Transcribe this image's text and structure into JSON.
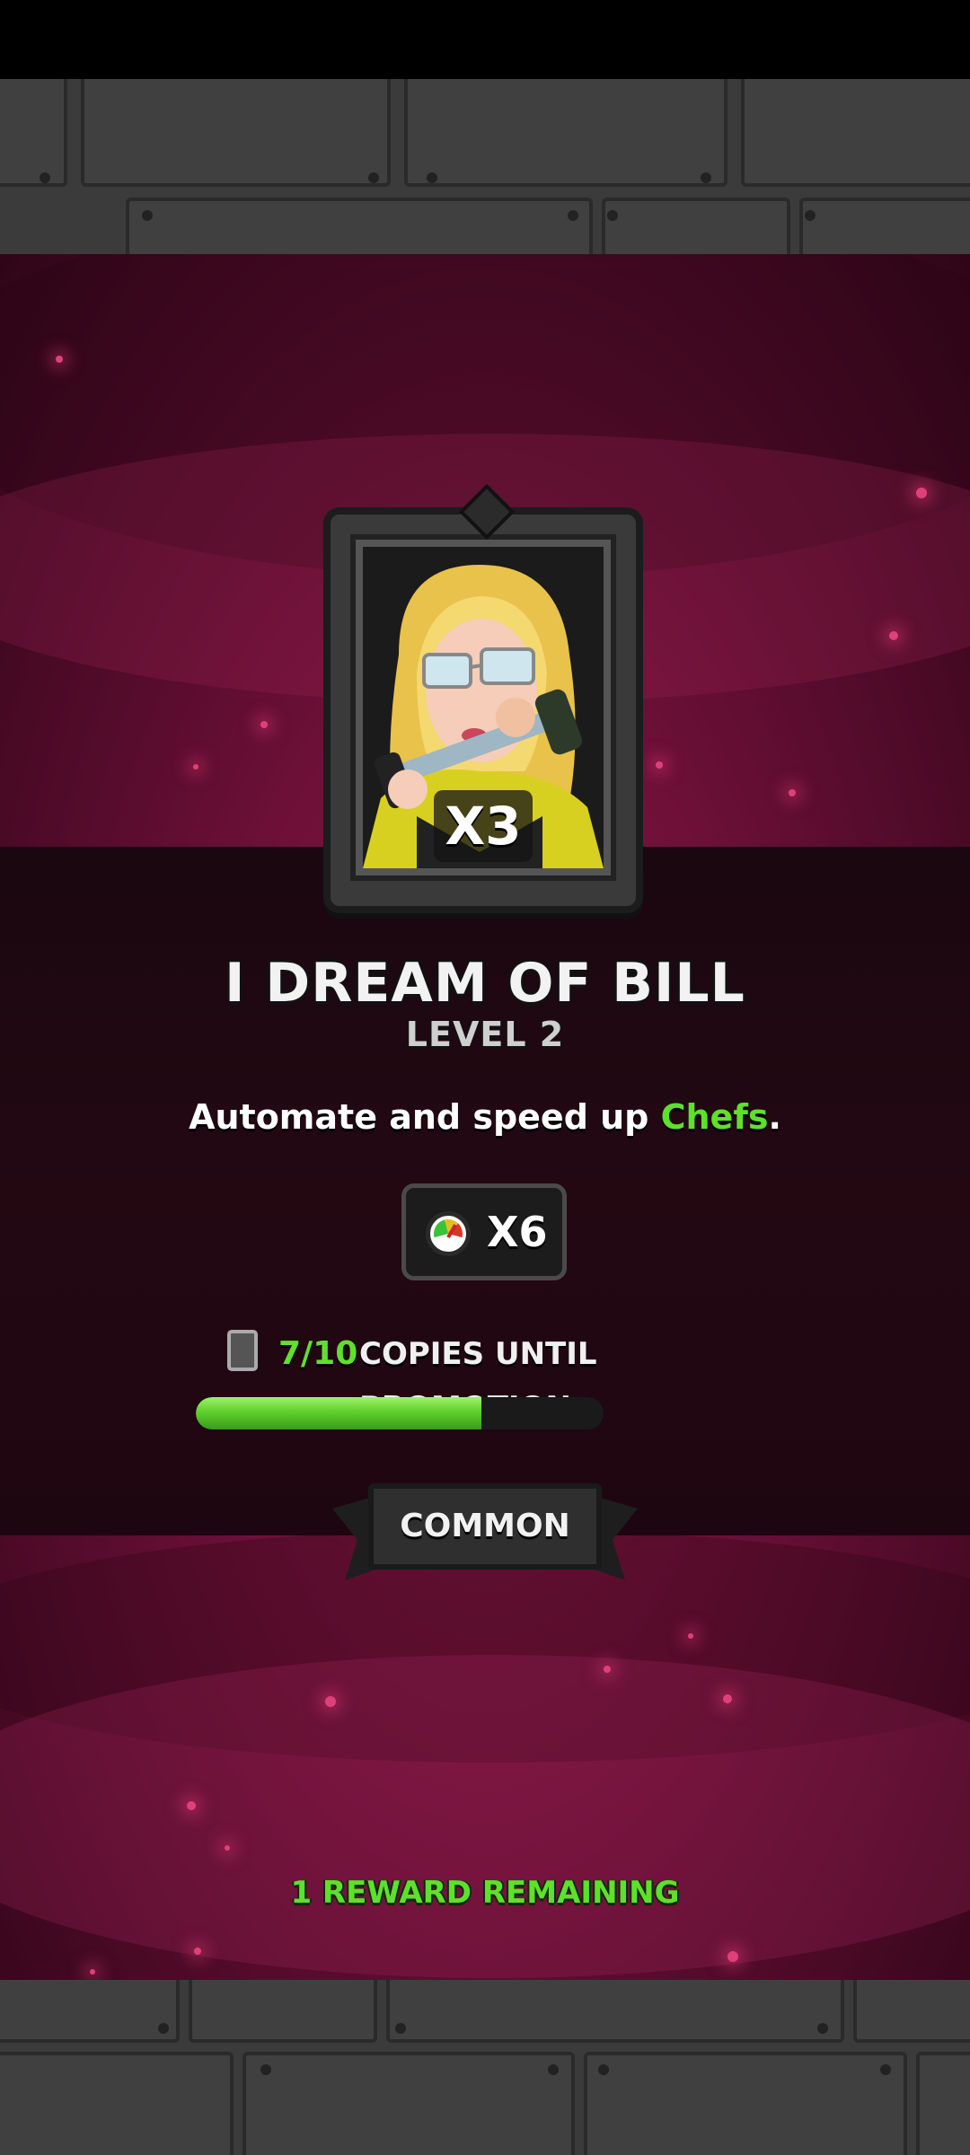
{
  "card": {
    "title": "I DREAM OF BILL",
    "level": "LEVEL 2",
    "multiplier": "X3",
    "rarity": "COMMON"
  },
  "description": {
    "prefix": "Automate and speed up ",
    "highlight": "Chefs",
    "suffix": "."
  },
  "boost": {
    "icon": "speedometer-icon",
    "value": "X6"
  },
  "promotion": {
    "count": "7/10",
    "label": "COPIES UNTIL PROMOTION",
    "progress_fraction": 0.7
  },
  "footer": {
    "remaining": "1 REWARD REMAINING"
  },
  "colors": {
    "accent_green": "#5fe02c",
    "background_magenta": "#6e1038"
  }
}
